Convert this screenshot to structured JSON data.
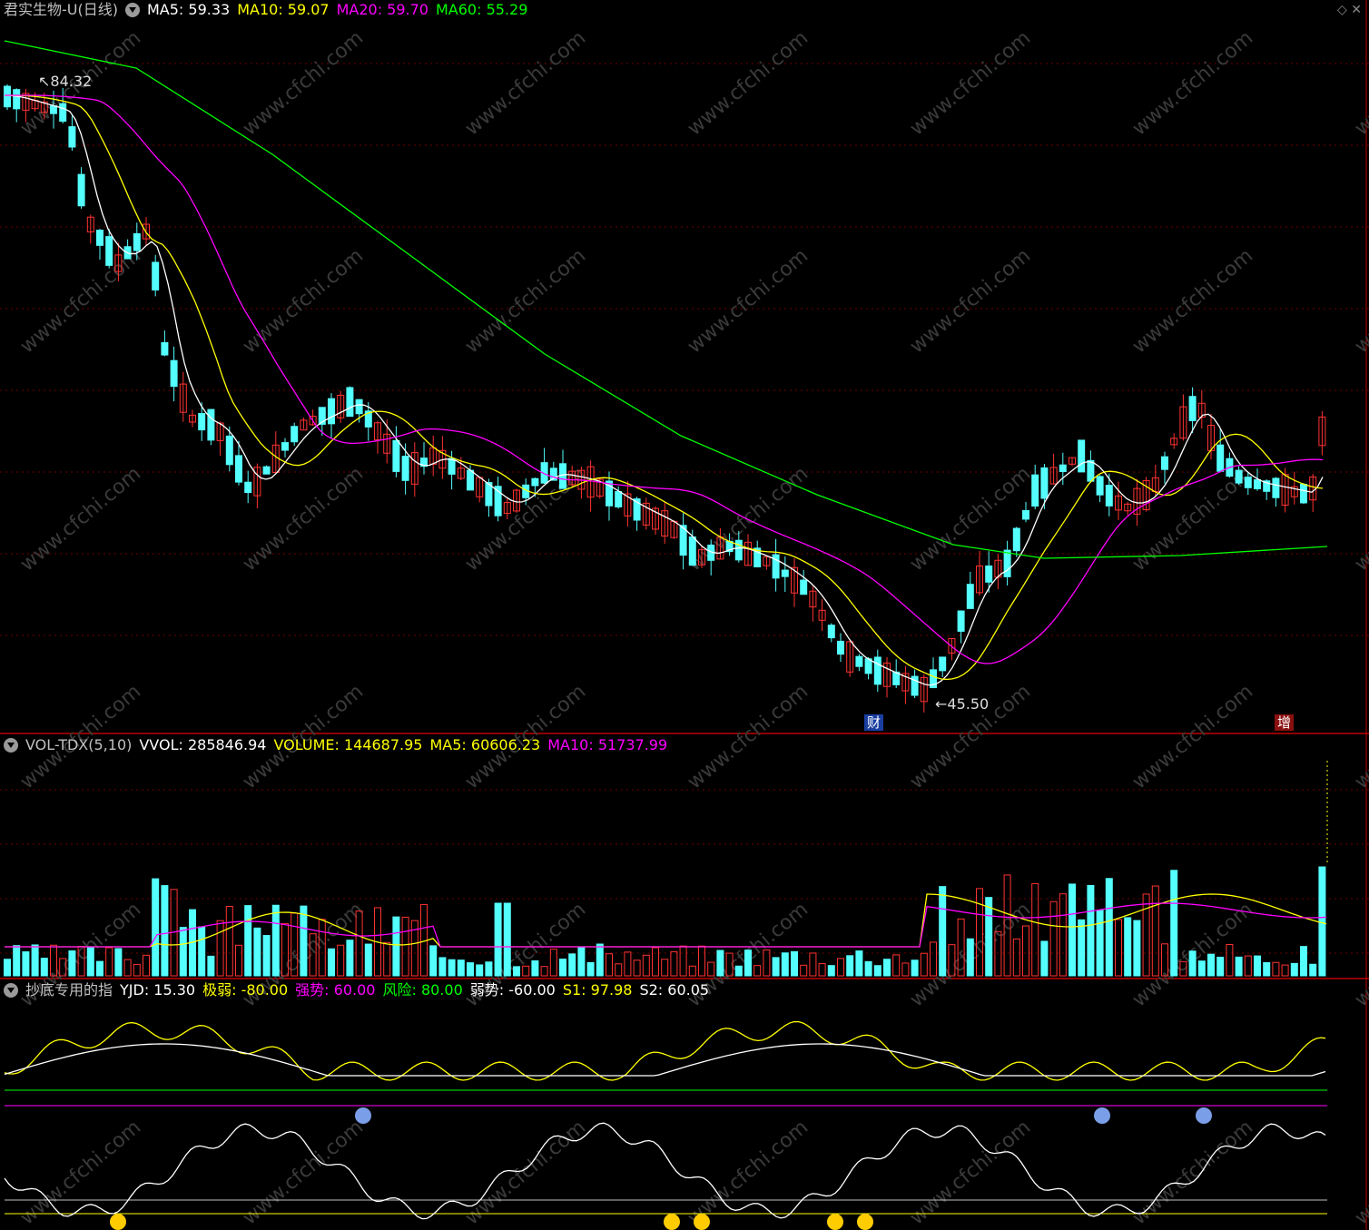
{
  "window": {
    "title": "君实生物-U(日线)",
    "ma": [
      {
        "label": "MA5: 59.33",
        "color": "#ffffff"
      },
      {
        "label": "MA10: 59.07",
        "color": "#ffff00"
      },
      {
        "label": "MA20: 59.70",
        "color": "#ff00ff"
      },
      {
        "label": "MA60: 55.29",
        "color": "#00ff00"
      }
    ],
    "high_label": "84.32",
    "low_label": "45.50",
    "marker_cai": "财",
    "marker_zeng": "增",
    "icons": [
      "diamond-icon",
      "close-icon"
    ]
  },
  "volume_panel": {
    "name": "VOL-TDX(5,10)",
    "items": [
      {
        "label": "VVOL: 285846.94",
        "color": "#ffffff"
      },
      {
        "label": "VOLUME: 144687.95",
        "color": "#ffff00"
      },
      {
        "label": "MA5: 60606.23",
        "color": "#ffff00"
      },
      {
        "label": "MA10: 51737.99",
        "color": "#ff00ff"
      }
    ]
  },
  "indicator_panel": {
    "name": "抄底专用的指",
    "items": [
      {
        "label": "YJD: 15.30",
        "color": "#ffffff"
      },
      {
        "label": "极弱: -80.00",
        "color": "#ffff00"
      },
      {
        "label": "强势: 60.00",
        "color": "#ff00ff"
      },
      {
        "label": "风险: 80.00",
        "color": "#00ff00"
      },
      {
        "label": "弱势: -60.00",
        "color": "#ffffff"
      },
      {
        "label": "S1: 97.98",
        "color": "#ffff00"
      },
      {
        "label": "S2: 60.05",
        "color": "#ffffff"
      }
    ]
  },
  "watermark": "www.cfchi.com",
  "colors": {
    "up": "#ff3232",
    "down": "#54ffff",
    "grid": "#6e0000",
    "frame": "#c00000"
  }
}
